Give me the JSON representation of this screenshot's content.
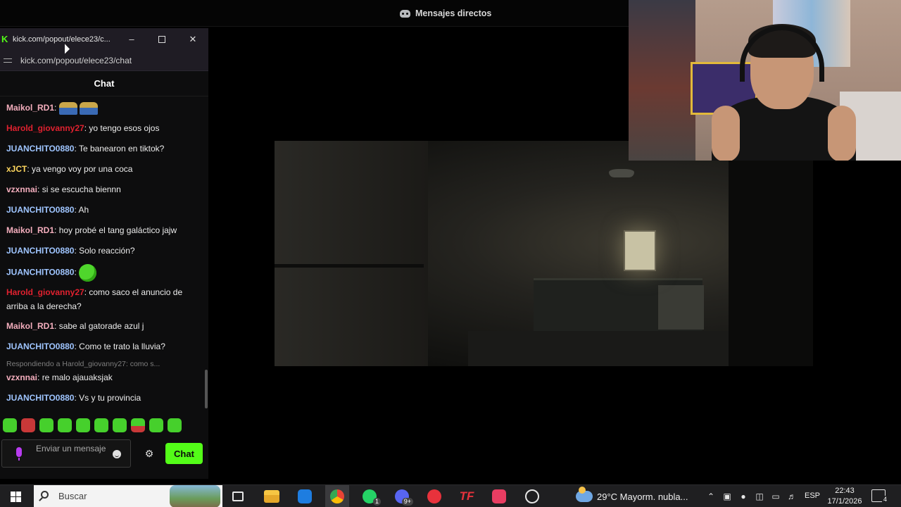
{
  "discord": {
    "title": "Mensajes directos",
    "icon": "discord-icon"
  },
  "popup": {
    "window_title": "kick.com/popout/elece23/c...",
    "url": "kick.com/popout/elece23/chat",
    "chat_header": "Chat",
    "messages": [
      {
        "user": "Maikol_RD1",
        "color": "#f4aebd",
        "text": "",
        "emotes": [
          "car-emote",
          "car-emote"
        ]
      },
      {
        "user": "Harold_giovanny27",
        "color": "#e0212f",
        "text": "yo tengo esos ojos"
      },
      {
        "user": "JUANCHITO0880",
        "color": "#9fc5ff",
        "text": "Te banearon en tiktok?"
      },
      {
        "user": "xJCT",
        "color": "#ffd75e",
        "text": "ya vengo voy por una coca"
      },
      {
        "user": "vzxnnai",
        "color": "#f4aebd",
        "text": "si se escucha biennn"
      },
      {
        "user": "JUANCHITO0880",
        "color": "#9fc5ff",
        "text": "Ah"
      },
      {
        "user": "Maikol_RD1",
        "color": "#f4aebd",
        "text": "hoy probé el tang galáctico jajw"
      },
      {
        "user": "JUANCHITO0880",
        "color": "#9fc5ff",
        "text": "Solo reacción?"
      },
      {
        "user": "JUANCHITO0880",
        "color": "#9fc5ff",
        "text": "",
        "emotes": [
          "slime-emote"
        ]
      },
      {
        "user": "Harold_giovanny27",
        "color": "#e0212f",
        "text": "como saco el anuncio de arriba a la derecha?"
      },
      {
        "user": "Maikol_RD1",
        "color": "#f4aebd",
        "text": "sabe al gatorade azul j"
      },
      {
        "user": "JUANCHITO0880",
        "color": "#9fc5ff",
        "text": "Como te trato la lluvia?"
      },
      {
        "user": "vzxnnai",
        "color": "#f4aebd",
        "text": "re malo ajauaksjak"
      },
      {
        "user": "JUANCHITO0880",
        "color": "#9fc5ff",
        "text": "Vs y tu provincia"
      }
    ],
    "reply_text": "Respondiendo a Harold_giovanny27: como s...",
    "input_placeholder": "Enviar un mensaje",
    "chat_button": "Chat",
    "accent": "#53fc18"
  },
  "taskbar": {
    "search_placeholder": "Buscar",
    "weather": "29°C  Mayorm. nubla...",
    "language": "ESP",
    "time": "22:43",
    "date": "17/1/2026",
    "whatsapp_badge": "1",
    "discord_badge": "9+",
    "notifications": "4"
  }
}
